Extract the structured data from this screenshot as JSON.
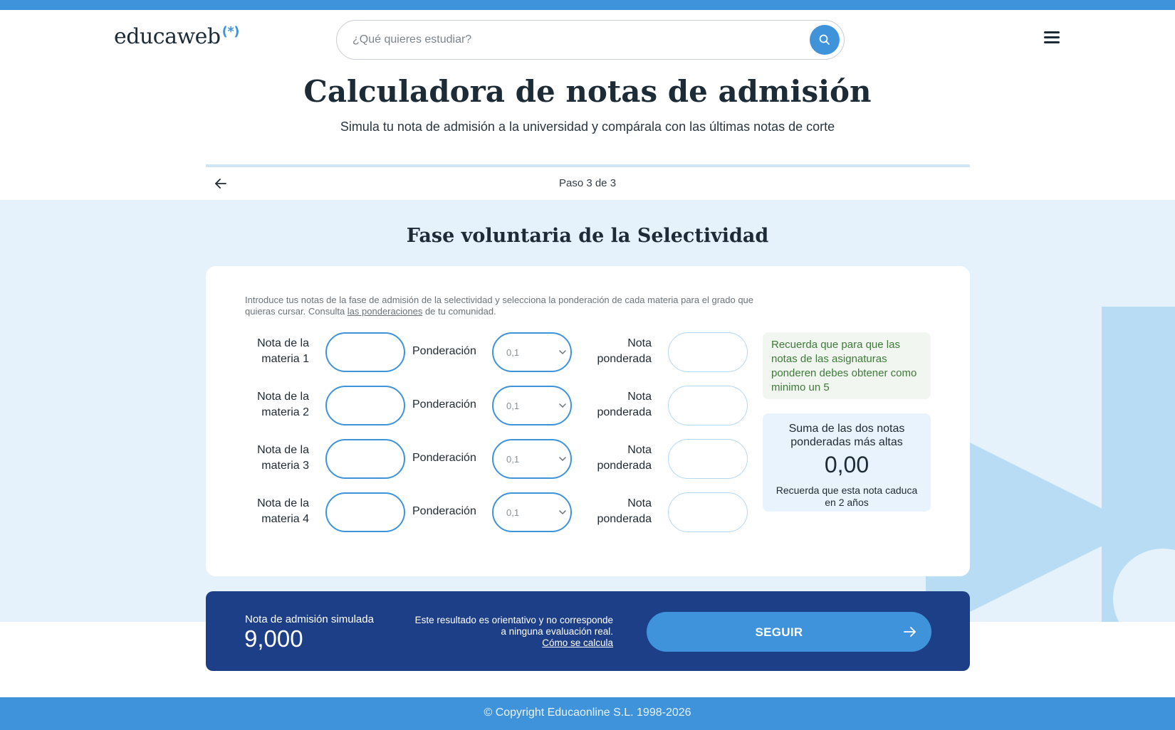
{
  "header": {
    "logo": "educaweb",
    "logo_mark": "(*)",
    "search_placeholder": "¿Qué quieres estudiar?",
    "search_icon": "search-icon",
    "menu_icon": "hamburger-menu-icon"
  },
  "page": {
    "title": "Calculadora de notas de admisión",
    "subtitle": "Simula tu nota de admisión a la universidad y compárala con las últimas notas de corte",
    "step": "Paso 3 de 3",
    "step_progress": 1.0,
    "back_icon": "arrow-left-icon"
  },
  "section": {
    "title": "Fase voluntaria de la Selectividad",
    "intro_text": "Introduce tus notas de la fase de admisión de la selectividad y selecciona la ponderación de cada materia para el grado que quieras cursar. Consulta ",
    "intro_link": "las ponderaciones",
    "intro_tail": " de tu comunidad.",
    "rows": [
      {
        "materia_label_1": "Nota de la",
        "materia_label_2": "materia 1",
        "pond_label": "Ponderación",
        "pond_value": "0,1",
        "nota_label_1": "Nota",
        "nota_label_2": "ponderada"
      },
      {
        "materia_label_1": "Nota de la",
        "materia_label_2": "materia 2",
        "pond_label": "Ponderación",
        "pond_value": "0,1",
        "nota_label_1": "Nota",
        "nota_label_2": "ponderada"
      },
      {
        "materia_label_1": "Nota de la",
        "materia_label_2": "materia 3",
        "pond_label": "Ponderación",
        "pond_value": "0,1",
        "nota_label_1": "Nota",
        "nota_label_2": "ponderada"
      },
      {
        "materia_label_1": "Nota de la",
        "materia_label_2": "materia 4",
        "pond_label": "Ponderación",
        "pond_value": "0,1",
        "nota_label_1": "Nota",
        "nota_label_2": "ponderada"
      }
    ],
    "hint": "Recuerda que para que las notas de las asignaturas ponderen debes obtener como minimo un 5",
    "sum_title": "Suma de las dos notas ponderadas más altas",
    "sum_value": "0,00",
    "sum_note": "Recuerda que esta nota caduca en 2 años"
  },
  "result": {
    "label": "Nota de admisión simulada",
    "value": "9,000",
    "disclaimer": "Este resultado es orientativo y no corresponde a ninguna evaluación real.",
    "link": "Cómo se calcula",
    "button": "SEGUIR",
    "button_icon": "arrow-right-icon"
  },
  "footer": {
    "copyright": "© Copyright Educaonline S.L. 1998-2026"
  },
  "colors": {
    "accent": "#3f93da",
    "navy": "#1d3f88",
    "band": "#e5f2fc",
    "hint_bg": "#f1f6f0",
    "hint_text": "#3f7a3a"
  }
}
